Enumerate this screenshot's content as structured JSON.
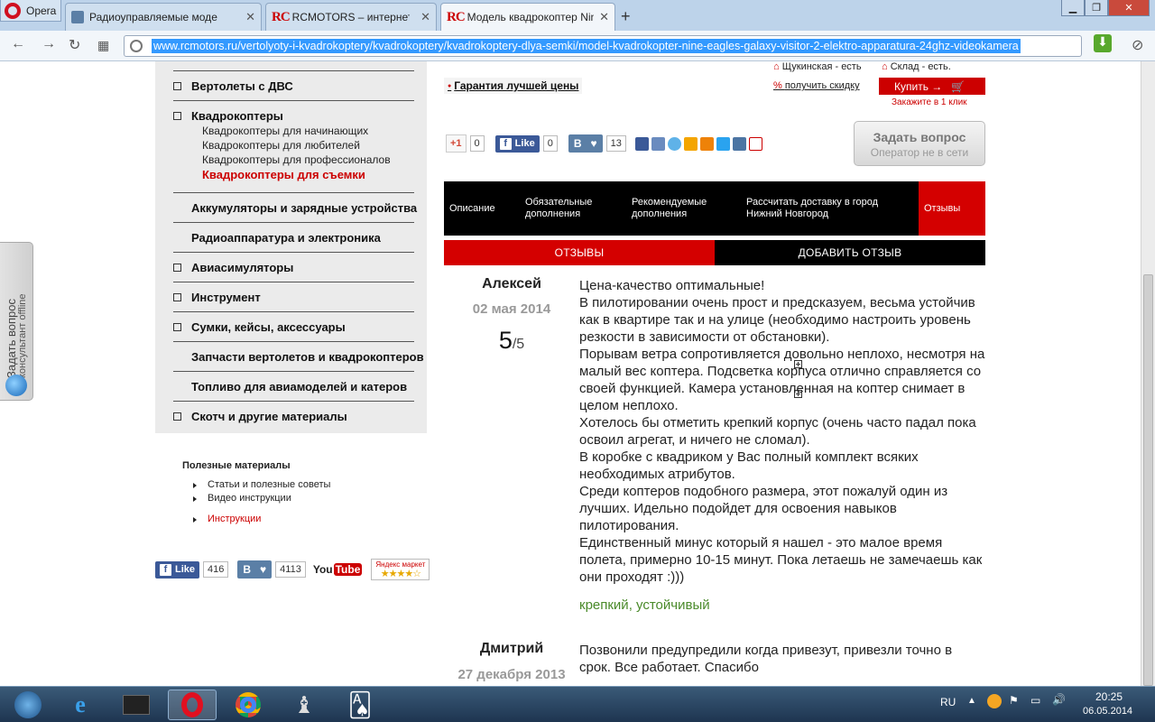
{
  "browser": {
    "menu_label": "Opera",
    "tabs": [
      {
        "label": "Радиоуправляемые моде"
      },
      {
        "label": "RCMOTORS – интернет-м"
      },
      {
        "label": "Модель квадрокоптер Nin"
      }
    ],
    "tab_logo": "RC",
    "url": "www.rcmotors.ru/vertolyoty-i-kvadrokoptery/kvadrokoptery/kvadrokoptery-dlya-semki/model-kvadrokopter-nine-eagles-galaxy-visitor-2-elektro-apparatura-24ghz-videokamera"
  },
  "sidebar": {
    "categories": [
      {
        "label": "Вертолеты с ДВС"
      },
      {
        "label": "Квадрокоптеры"
      },
      {
        "label": "Аккумуляторы и зарядные устройства"
      },
      {
        "label": "Радиоаппаратура и электроника"
      },
      {
        "label": "Авиасимуляторы"
      },
      {
        "label": "Инструмент"
      },
      {
        "label": "Сумки, кейсы, аксессуары"
      },
      {
        "label": "Запчасти вертолетов и квадрокоптеров"
      },
      {
        "label": "Топливо для авиамоделей и катеров"
      },
      {
        "label": "Скотч и другие материалы"
      }
    ],
    "subcategories": [
      {
        "label": "Квадрокоптеры для начинающих"
      },
      {
        "label": "Квадрокоптеры для любителей"
      },
      {
        "label": "Квадрокоптеры для профессионалов"
      },
      {
        "label": "Квадрокоптеры для съемки"
      }
    ]
  },
  "useful": {
    "title": "Полезные материалы",
    "items": [
      {
        "label": "Статьи и полезные советы"
      },
      {
        "label": "Видео инструкции"
      },
      {
        "label": "Инструкции"
      }
    ]
  },
  "social_bottom": {
    "fb_label": "Like",
    "fb_count": "416",
    "vk_label": "В",
    "vk_count": "4113",
    "youtube_a": "You",
    "youtube_b": "Tube",
    "yandex_label": "Яндекс маркет",
    "yandex_stars": "★★★★☆"
  },
  "product": {
    "store1": "Щукинская - есть",
    "store2": "Склад - есть.",
    "discount": "получить скидку",
    "buy_label": "Купить →",
    "one_click": "Закажите в 1 клик",
    "guarantee": "Гарантия лучшей цены",
    "gplus_label": "+1",
    "gplus_count": "0",
    "fb_label": "Like",
    "fb_count": "0",
    "vk_label": "В",
    "vk_count": "13",
    "ask_title": "Задать вопрос",
    "ask_sub": "Оператор не в сети"
  },
  "tabs": [
    {
      "label": "Описание"
    },
    {
      "label": "Обязательные дополнения"
    },
    {
      "label": "Рекомендуемые дополнения"
    },
    {
      "label": "Рассчитать доставку в город Нижний Новгород"
    },
    {
      "label": "Отзывы"
    }
  ],
  "review_tabs": {
    "reviews": "ОТЗЫВЫ",
    "add": "ДОБАВИТЬ ОТЗЫВ"
  },
  "reviews": [
    {
      "author": "Алексей",
      "date": "02 мая 2014",
      "score": "5",
      "max": "/5",
      "text": "Цена-качество оптимальные!\nВ пилотировании очень прост и предсказуем, весьма устойчив как в квартире так и на улице (необходимо настроить уровень резкости в зависимости от обстановки).\nПорывам ветра сопротивляется довольно неплохо, несмотря на малый вес коптера. Подсветка корпуса отлично справляется со своей функцией. Камера установленная на коптер снимает в целом неплохо.\nХотелось бы отметить крепкий корпус (очень часто падал пока освоил агрегат, и ничего не сломал).\nВ коробке с квадриком у Вас полный комплект всяких необходимых атрибутов.\nСреди коптеров подобного размера, этот пожалуй один из лучших. Идельно подойдет для освоения навыков пилотирования.\nЕдинственный минус который я нашел - это малое время полета, примерно 10-15 минут. Пока летаешь не замечаешь как они проходят :)))",
      "tags": "крепкий, устойчивый"
    },
    {
      "author": "Дмитрий",
      "date": "27 декабря 2013",
      "text": "Позвонили предупредили когда привезут, привезли точно в срок. Все работает. Спасибо"
    }
  ],
  "side_widget": {
    "title": "Задать вопрос",
    "subtitle": "консультант offline"
  },
  "taskbar": {
    "lang": "RU",
    "time": "20:25",
    "date": "06.05.2014"
  },
  "colors": {
    "brand_red": "#d40000",
    "link_green": "#4a8a2a",
    "selection": "#3399ff"
  }
}
